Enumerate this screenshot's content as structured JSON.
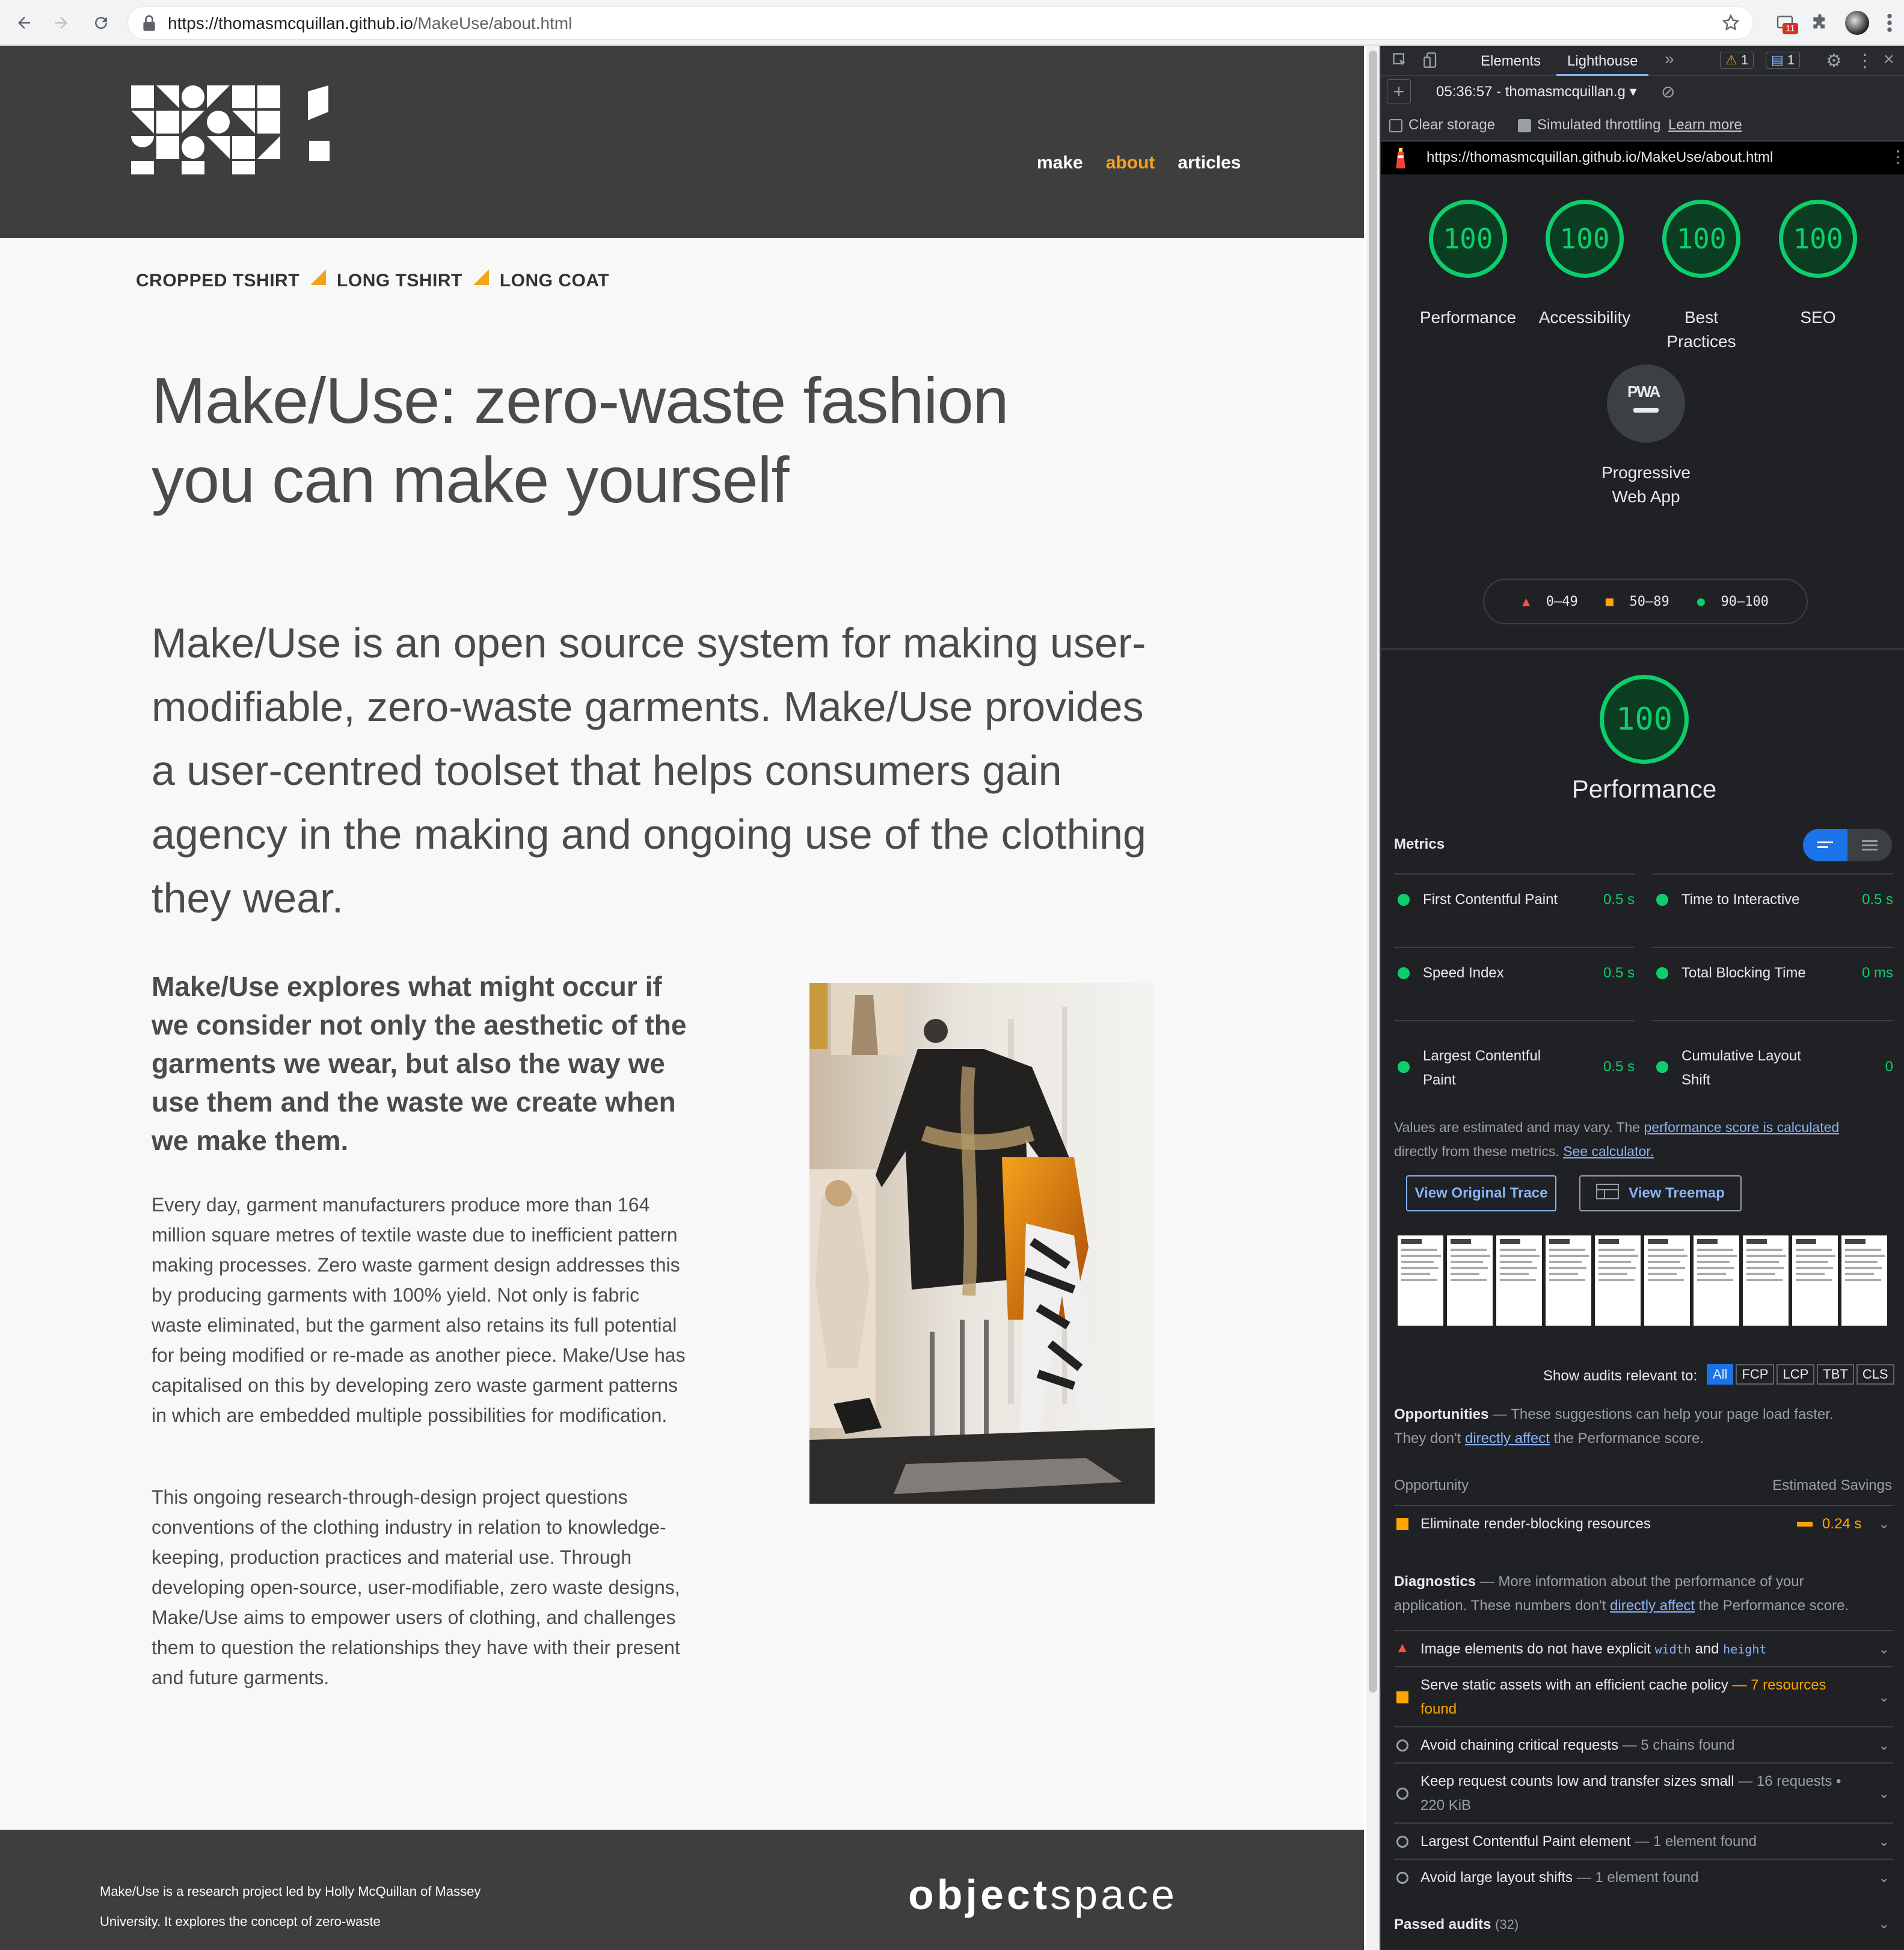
{
  "browser": {
    "url_host": "https://thomasmcquillan.github.io",
    "url_path": "/MakeUse/about.html",
    "notification_count": "11"
  },
  "site": {
    "nav": {
      "make": "make",
      "about": "about",
      "articles": "articles"
    },
    "nav_active_color": "#f3a31c",
    "breadcrumb": [
      "CROPPED TSHIRT",
      "LONG TSHIRT",
      "LONG COAT"
    ],
    "title": "Make/Use: zero-waste fashion you can make yourself",
    "lead": "Make/Use is an open source system for making user-modifiable, zero-waste garments. Make/Use provides a user-centred toolset that helps consumers gain agency in the making and ongoing use of the clothing they wear.",
    "sub_lead": "Make/Use explores what might occur if we consider not only the aesthetic of the garments we wear, but also the way we use them and the waste we create when we make them.",
    "para1": "Every day, garment manufacturers produce more than 164 million square metres of textile waste due to inefficient pattern making processes. Zero waste garment design addresses this by producing garments with 100% yield. Not only is fabric waste eliminated, but the garment also retains its full potential for being modified or re-made as another piece. Make/Use has capitalised on this by developing zero waste garment patterns in which are embedded multiple possibilities for modification.",
    "para2": "This ongoing research-through-design project questions conventions of the clothing industry in relation to knowledge-keeping, production practices and material use. Through developing open-source, user-modifiable, zero waste designs, Make/Use aims to empower users of clothing, and challenges them to question the relationships they have with their present and future garments.",
    "footer_text": "Make/Use is a research project led by Holly McQuillan of Massey University. It explores the concept of zero-waste",
    "footer_logo_bold": "object",
    "footer_logo_light": "space"
  },
  "devtools": {
    "tabs": {
      "elements": "Elements",
      "lighthouse": "Lighthouse",
      "more": "»"
    },
    "warn_count": "1",
    "msg_count": "1",
    "report_select": "05:36:57 - thomasmcquillan.g ▾",
    "clear_storage": "Clear storage",
    "simulated_throttling": "Simulated throttling",
    "learn_more": "Learn more",
    "report_url": "https://thomasmcquillan.github.io/MakeUse/about.html",
    "categories": [
      {
        "score": "100",
        "label": "Performance"
      },
      {
        "score": "100",
        "label": "Accessibility"
      },
      {
        "score": "100",
        "label": "Best Practices"
      },
      {
        "score": "100",
        "label": "SEO"
      }
    ],
    "pwa_badge": "PWA",
    "pwa_label": "Progressive Web App",
    "legend": {
      "fail": "0–49",
      "average": "50–89",
      "pass": "90–100"
    },
    "perf_score": "100",
    "perf_title": "Performance",
    "metrics_title": "Metrics",
    "metrics": [
      {
        "name": "First Contentful Paint",
        "value": "0.5 s"
      },
      {
        "name": "Time to Interactive",
        "value": "0.5 s"
      },
      {
        "name": "Speed Index",
        "value": "0.5 s"
      },
      {
        "name": "Total Blocking Time",
        "value": "0 ms"
      },
      {
        "name": "Largest Contentful Paint",
        "value": "0.5 s"
      },
      {
        "name": "Cumulative Layout Shift",
        "value": "0"
      }
    ],
    "estimate_note_1": "Values are estimated and may vary. The",
    "estimate_link_1": "performance score is calculated",
    "estimate_note_2": "directly from these metrics.",
    "estimate_link_2": "See calculator.",
    "view_trace": "View Original Trace",
    "view_treemap": "View Treemap",
    "show_audits": "Show audits relevant to:",
    "filters": [
      "All",
      "FCP",
      "LCP",
      "TBT",
      "CLS"
    ],
    "opportunities_title": "Opportunities",
    "opportunities_desc_1": "— These suggestions can help your page load faster.",
    "opportunities_desc_2a": "They don't",
    "opportunities_desc_link": "directly affect",
    "opportunities_desc_2b": "the Performance score.",
    "opp_col_left": "Opportunity",
    "opp_col_right": "Estimated Savings",
    "opp_item": "Eliminate render-blocking resources",
    "opp_value": "0.24 s",
    "diagnostics_title": "Diagnostics",
    "diagnostics_desc_1": "— More information about the performance of your",
    "diagnostics_desc_2a": "application. These numbers don't",
    "diagnostics_desc_link": "directly affect",
    "diagnostics_desc_2b": "the Performance score.",
    "diag1_a": "Image elements do not have explicit",
    "diag1_code1": "width",
    "diag1_and": "and",
    "diag1_code2": "height",
    "diag2": "Serve static assets with an efficient cache policy",
    "diag2_detail": "— 7 resources found",
    "diag3": "Avoid chaining critical requests",
    "diag3_detail": "— 5 chains found",
    "diag4": "Keep request counts low and transfer sizes small",
    "diag4_detail": "— 16 requests • 220 KiB",
    "diag5": "Largest Contentful Paint element",
    "diag5_detail": "— 1 element found",
    "diag6": "Avoid large layout shifts",
    "diag6_detail": "— 1 element found",
    "passed_audits": "Passed audits",
    "passed_count": "(32)"
  },
  "colors": {
    "pass": "#0cce6b",
    "average": "#ffa400",
    "fail": "#ff4e42",
    "link": "#8ab4f8"
  }
}
